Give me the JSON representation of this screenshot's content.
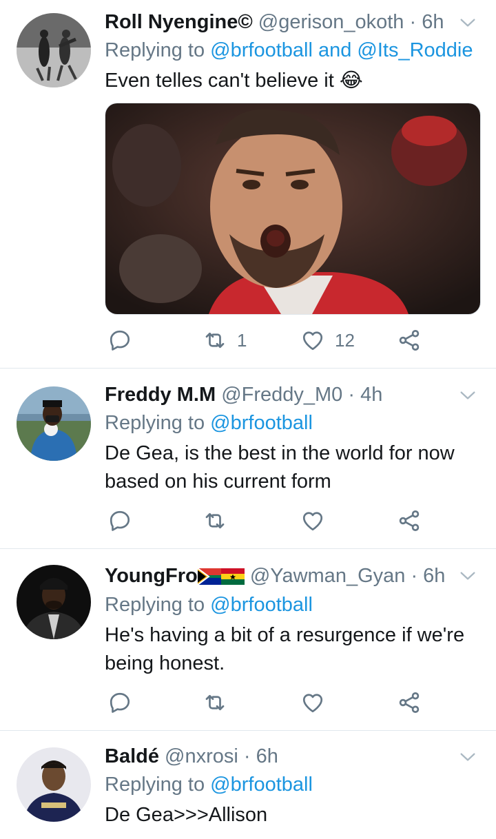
{
  "tweets": [
    {
      "name": "Roll Nyengine©",
      "handle": "@gerison_okoth",
      "time": "· 6h",
      "reply_prefix": "Replying to",
      "reply_to": "@brfootball and @Its_Roddie",
      "text": "Even telles can't believe it",
      "emoji": "😂",
      "retweets": "1",
      "likes": "12"
    },
    {
      "name": "Freddy M.M",
      "handle": "@Freddy_M0",
      "time": "· 4h",
      "reply_prefix": "Replying to",
      "reply_to": "@brfootball",
      "text": "De Gea, is the best in the world for now based on his current form"
    },
    {
      "name": "YoungFro",
      "handle": "@Yawman_Gyan",
      "time": "· 6h",
      "reply_prefix": "Replying to",
      "reply_to": "@brfootball",
      "text": "He's having a bit of a resurgence if we're being honest."
    },
    {
      "name": "Baldé",
      "handle": "@nxrosi",
      "time": "· 6h",
      "reply_prefix": "Replying to",
      "reply_to": "@brfootball",
      "text": "De Gea>>>Allison"
    }
  ],
  "icons": {
    "reply": "reply-icon",
    "retweet": "retweet-icon",
    "like": "heart-icon",
    "share": "share-icon",
    "more": "chevron-down-icon"
  },
  "colors": {
    "link": "#1b95e0",
    "muted": "#657786",
    "text": "#14171a",
    "divider": "#e1e8ed"
  }
}
